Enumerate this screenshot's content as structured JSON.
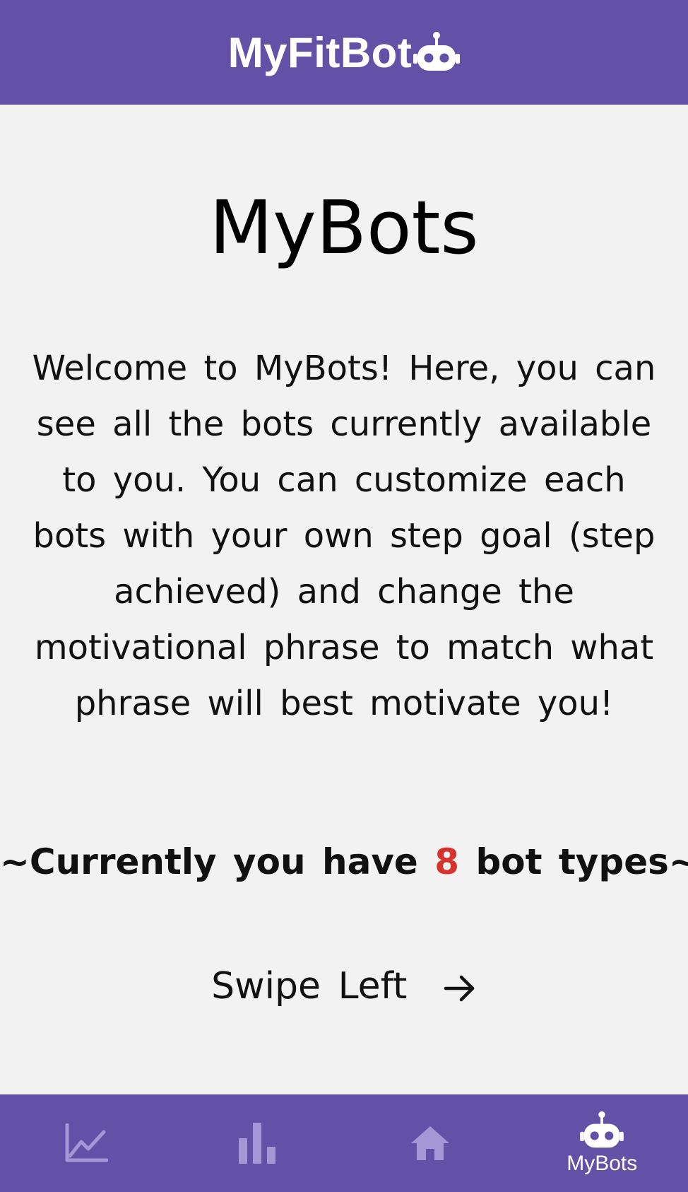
{
  "app": {
    "title": "MyFitBot",
    "brand_icon": "robot-icon"
  },
  "page": {
    "title": "MyBots",
    "intro": "Welcome to MyBots! Here, you can see all the bots currently available to you. You can customize each bots with your own step goal (step achieved) and change the motivational phrase to match what phrase will best motivate you!",
    "count_prefix": "~Currently you have ",
    "count_value": "8",
    "count_suffix": " bot types~",
    "swipe_label": "Swipe Left",
    "swipe_icon": "arrow-right-icon"
  },
  "nav": {
    "items": [
      {
        "icon": "line-chart-icon",
        "label": "",
        "active": false
      },
      {
        "icon": "bar-chart-icon",
        "label": "",
        "active": false
      },
      {
        "icon": "home-icon",
        "label": "",
        "active": false
      },
      {
        "icon": "robot-icon",
        "label": "MyBots",
        "active": true
      }
    ]
  },
  "colors": {
    "primary": "#6351a8",
    "background": "#f2f2f2",
    "accent_number": "#d6342a",
    "nav_inactive": "#a597d6",
    "nav_active": "#ffffff"
  }
}
